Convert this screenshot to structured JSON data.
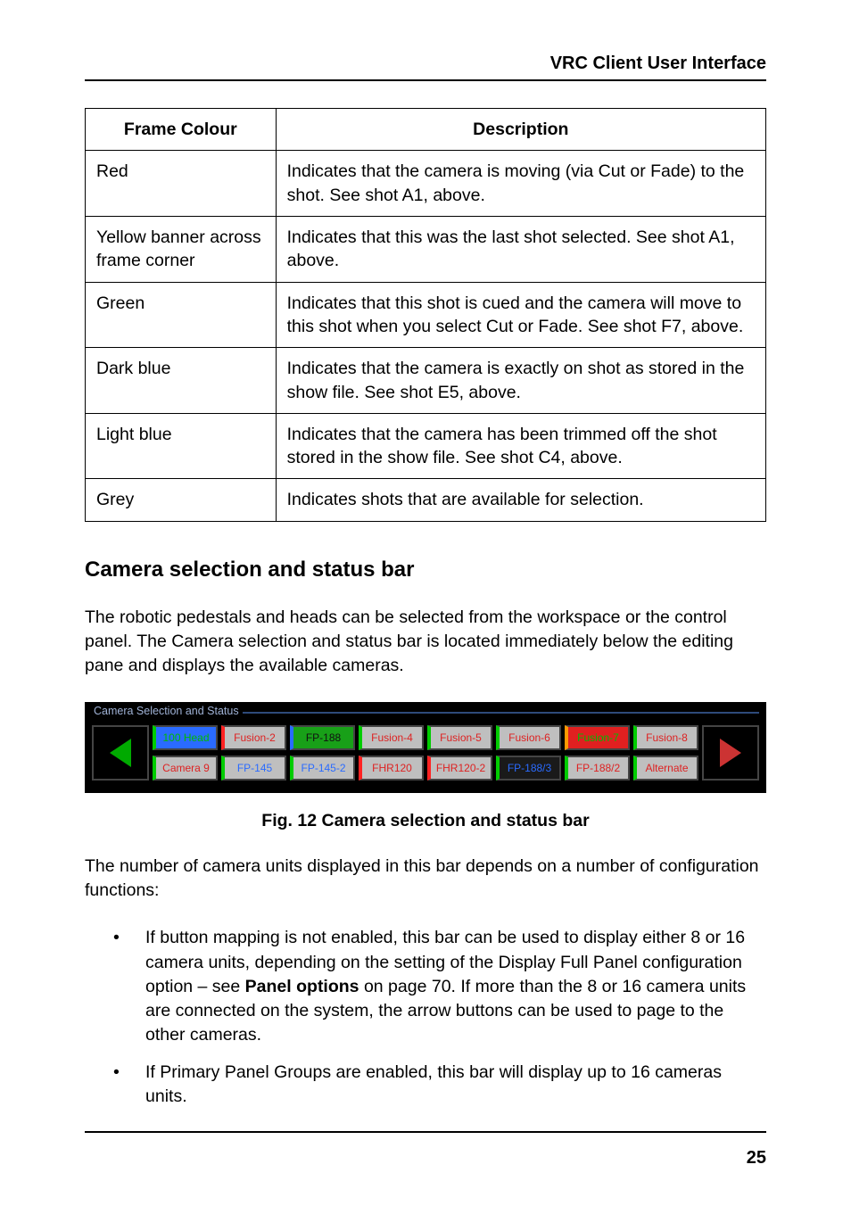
{
  "header": {
    "title": "VRC Client User Interface"
  },
  "table": {
    "headers": {
      "col1": "Frame Colour",
      "col2": "Description"
    },
    "rows": {
      "r0": {
        "c0": "Red",
        "c1": "Indicates that the camera is moving (via Cut or Fade) to the shot. See shot A1, above."
      },
      "r1": {
        "c0": "Yellow banner across frame corner",
        "c1": "Indicates that this was the last shot selected. See shot A1, above."
      },
      "r2": {
        "c0": "Green",
        "c1": "Indicates that this shot is cued and the camera will move to this shot when you select Cut or Fade. See shot F7, above."
      },
      "r3": {
        "c0": "Dark blue",
        "c1": "Indicates that the camera is exactly on shot as stored in the show file. See shot E5, above."
      },
      "r4": {
        "c0": "Light blue",
        "c1": "Indicates that the camera has been trimmed off the shot stored in the show file. See shot C4, above."
      },
      "r5": {
        "c0": "Grey",
        "c1": "Indicates shots that are available for selection."
      }
    }
  },
  "section": {
    "heading": "Camera selection and status bar",
    "intro": "The robotic pedestals and heads can be selected from the workspace or the control panel. The Camera selection and status bar is located immediately below the editing pane and displays the available cameras.",
    "post_fig": "The number of camera units displayed in this bar depends on a number of configuration functions:",
    "fig_caption": "Fig. 12  Camera selection and status bar"
  },
  "figure": {
    "label": "Camera Selection and Status",
    "rows": {
      "top": [
        "100 Head",
        "Fusion-2",
        "FP-188",
        "Fusion-4",
        "Fusion-5",
        "Fusion-6",
        "Fusion-7",
        "Fusion-8"
      ],
      "bot": [
        "Camera 9",
        "FP-145",
        "FP-145-2",
        "FHR120",
        "FHR120-2",
        "FP-188/3",
        "FP-188/2",
        "Alternate"
      ]
    }
  },
  "bullets": {
    "b0_a": "If button mapping is not enabled, this bar can be used to display either 8 or 16 camera units, depending on the setting of the Display Full Panel configuration option – see ",
    "b0_b": "Panel options",
    "b0_c": " on page 70. If more than the 8 or 16 camera units are connected on the system, the arrow buttons can be used to page to the other cameras.",
    "b1": "If Primary Panel Groups are enabled, this bar will display up to 16 cameras units."
  },
  "footer": {
    "page": "25"
  }
}
